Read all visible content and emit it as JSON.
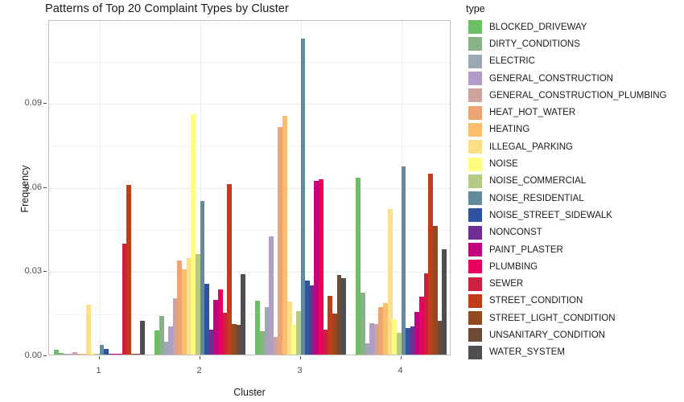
{
  "chart_data": {
    "type": "bar",
    "title": "Patterns of Top 20 Complaint Types by Cluster",
    "xlabel": "Cluster",
    "ylabel": "Frequency",
    "legend_title": "type",
    "legend_position": "right",
    "grid": true,
    "grouping": "dodge",
    "categories": [
      "1",
      "2",
      "3",
      "4"
    ],
    "ylim": [
      0.0,
      0.1195
    ],
    "y_ticks": [
      0.0,
      0.03,
      0.06,
      0.09
    ],
    "y_tick_labels": [
      "0.00",
      "0.03",
      "0.06",
      "0.09"
    ],
    "y_minor_ticks": [
      0.015,
      0.045,
      0.075,
      0.105
    ],
    "x_tick_labels": [
      "1",
      "2",
      "3",
      "4"
    ],
    "series": [
      {
        "name": "BLOCKED_DRIVEWAY",
        "color": "#6cbf62",
        "values": [
          0.0016,
          0.0086,
          0.0191,
          0.063
        ]
      },
      {
        "name": "DIRTY_CONDITIONS",
        "color": "#88b286",
        "values": [
          0.0006,
          0.0138,
          0.0084,
          0.0221
        ]
      },
      {
        "name": "ELECTRIC",
        "color": "#9da7b3",
        "values": [
          0.0002,
          0.0046,
          0.0169,
          0.004
        ]
      },
      {
        "name": "GENERAL_CONSTRUCTION",
        "color": "#b39cc8",
        "values": [
          0.0002,
          0.01,
          0.0422,
          0.0111
        ]
      },
      {
        "name": "GENERAL_CONSTRUCTION_PLUMBING",
        "color": "#cda39d",
        "values": [
          0.0008,
          0.02,
          0.0062,
          0.011
        ]
      },
      {
        "name": "HEAT_HOT_WATER",
        "color": "#eda372",
        "values": [
          0.0002,
          0.0336,
          0.0812,
          0.017
        ]
      },
      {
        "name": "HEATING",
        "color": "#fbbe6f",
        "values": [
          0.0002,
          0.0305,
          0.085,
          0.0184
        ]
      },
      {
        "name": "ILLEGAL_PARKING",
        "color": "#fcdf86",
        "values": [
          0.0178,
          0.0345,
          0.0189,
          0.052
        ]
      },
      {
        "name": "NOISE",
        "color": "#fdfd80",
        "values": [
          0.0005,
          0.0857,
          0.0106,
          0.0125
        ]
      },
      {
        "name": "NOISE_COMMERCIAL",
        "color": "#b6c987",
        "values": [
          0.0003,
          0.0357,
          0.0155,
          0.0078
        ]
      },
      {
        "name": "NOISE_RESIDENTIAL",
        "color": "#648b9b",
        "values": [
          0.0035,
          0.0547,
          0.1127,
          0.0672
        ]
      },
      {
        "name": "NOISE_STREET_SIDEWALK",
        "color": "#2f539e",
        "values": [
          0.0019,
          0.0253,
          0.0264,
          0.0096
        ]
      },
      {
        "name": "NONCONST",
        "color": "#6f2d91",
        "values": [
          0.0001,
          0.0089,
          0.0246,
          0.0099
        ]
      },
      {
        "name": "PAINT_PLASTER",
        "color": "#c1037e",
        "values": [
          0.0002,
          0.0196,
          0.062,
          0.0153
        ]
      },
      {
        "name": "PLUMBING",
        "color": "#e8005e",
        "values": [
          0.0003,
          0.0232,
          0.0625,
          0.0207
        ]
      },
      {
        "name": "SEWER",
        "color": "#cd1f3f",
        "values": [
          0.0395,
          0.0148,
          0.0089,
          0.029
        ]
      },
      {
        "name": "STREET_CONDITION",
        "color": "#c13c18",
        "values": [
          0.0604,
          0.0608,
          0.0209,
          0.0644
        ]
      },
      {
        "name": "STREET_LIGHT_CONDITION",
        "color": "#944a20",
        "values": [
          0.0002,
          0.011,
          0.0147,
          0.0459
        ]
      },
      {
        "name": "UNSANITARY_CONDITION",
        "color": "#6d4b34",
        "values": [
          0.0003,
          0.0107,
          0.0285,
          0.012
        ]
      },
      {
        "name": "WATER_SYSTEM",
        "color": "#4f4f51",
        "values": [
          0.012,
          0.0288,
          0.0273,
          0.0376
        ]
      }
    ]
  }
}
